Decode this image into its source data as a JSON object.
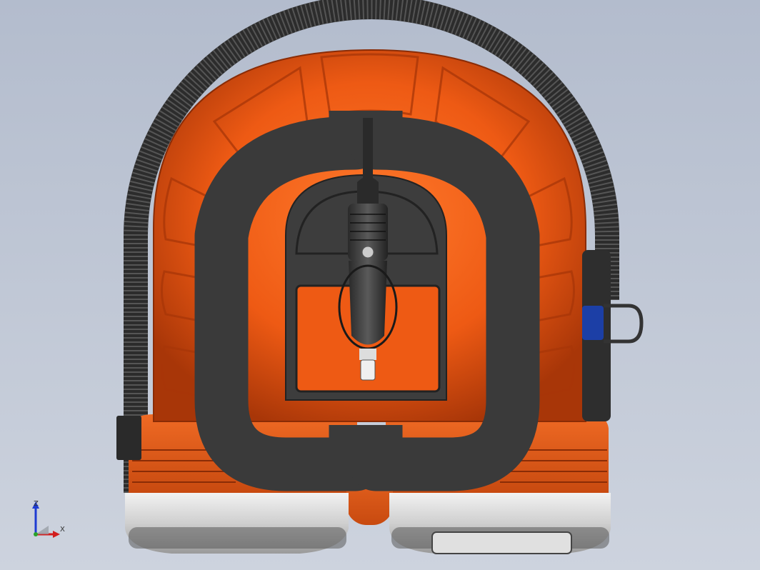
{
  "viewport": {
    "background_top": "#b3bccd",
    "background_bottom": "#cdd3de"
  },
  "model": {
    "body_color": "#ee5a14",
    "body_shadow_color": "#a83608",
    "hose_color": "#2c2c2c",
    "cord_wrap_color": "#3a3a3a",
    "chrome_color": "#d8d8d8",
    "blue_accent_color": "#1c3fa6"
  },
  "triad": {
    "x_label": "X",
    "z_label": "Z",
    "x_color": "#d21e1e",
    "y_color": "#2aa22a",
    "z_color": "#1e3cd2"
  }
}
